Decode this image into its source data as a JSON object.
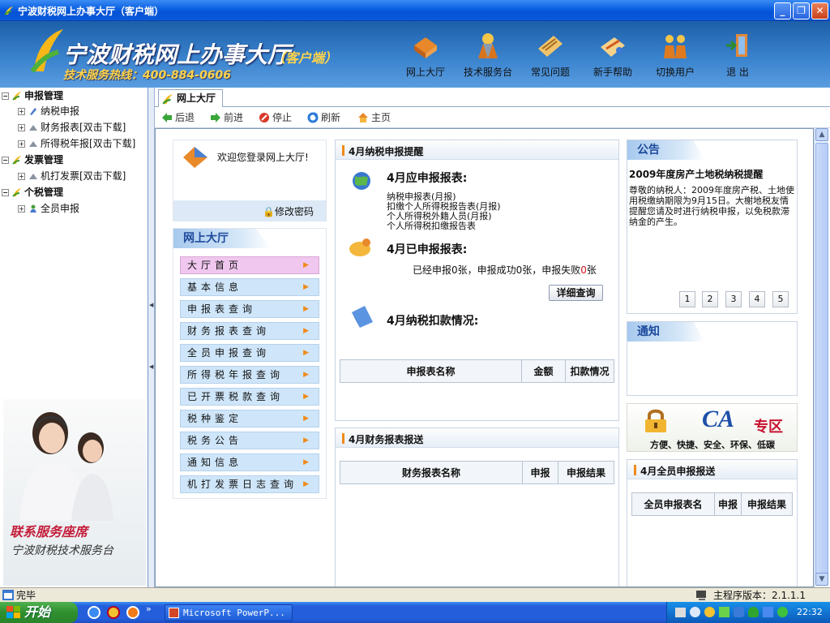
{
  "window": {
    "title": "宁波财税网上办事大厅（客户端）"
  },
  "banner": {
    "logo_text": "宁波财税网上办事大厅",
    "logo_sub": "（客户端）",
    "hotline": "技术服务热线：400-884-0606",
    "nav": [
      {
        "label": "网上大厅",
        "icon": "hall-icon"
      },
      {
        "label": "技术服务台",
        "icon": "service-desk-icon"
      },
      {
        "label": "常见问题",
        "icon": "faq-icon"
      },
      {
        "label": "新手帮助",
        "icon": "help-icon"
      },
      {
        "label": "切换用户",
        "icon": "switch-user-icon"
      },
      {
        "label": "退 出",
        "icon": "exit-icon"
      }
    ]
  },
  "tree": {
    "groups": [
      {
        "label": "申报管理",
        "children": [
          "纳税申报",
          "财务报表[双击下载]",
          "所得税年报[双击下载]"
        ]
      },
      {
        "label": "发票管理",
        "children": [
          "机打发票[双击下载]"
        ]
      },
      {
        "label": "个税管理",
        "children": [
          "全员申报"
        ]
      }
    ],
    "service": {
      "line1": "联系服务座席",
      "line2": "宁波财税技术服务台"
    }
  },
  "tabs": [
    {
      "label": "网上大厅"
    }
  ],
  "toolbar": {
    "back": "后退",
    "forward": "前进",
    "stop": "停止",
    "refresh": "刷新",
    "home": "主页"
  },
  "left_panel": {
    "welcome": "欢迎您登录网上大厅!",
    "change_password": "修改密码",
    "menu_title": "网上大厅",
    "menu": [
      "大厅首页",
      "基本信息",
      "申报表查询",
      "财务报表查询",
      "全员申报查询",
      "所得税年报查询",
      "已开票税款查询",
      "税种鉴定",
      "税务公告",
      "通知信息",
      "机打发票日志查询"
    ]
  },
  "reminder": {
    "title": "4月纳税申报提醒",
    "due_title": "4月应申报报表:",
    "due_items": [
      "纳税申报表(月报)",
      "扣缴个人所得税报告表(月报)",
      "个人所得税外籍人员(月报)",
      "个人所得税扣缴报告表"
    ],
    "done_title": "4月已申报报表:",
    "done_text": {
      "prefix": "已经申报0张，申报成功0张，申报失败",
      "fail_count": "0",
      "suffix": "张"
    },
    "detail_button": "详细查询",
    "deduct_title": "4月纳税扣款情况:",
    "deduct_columns": [
      "申报表名称",
      "金额",
      "扣款情况"
    ]
  },
  "finance": {
    "title": "4月财务报表报送",
    "columns": [
      "财务报表名称",
      "申报",
      "申报结果"
    ]
  },
  "notice": {
    "title": "公告",
    "headline": "2009年度房产土地税纳税提醒",
    "body": "尊敬的纳税人：2009年度房产税、土地使用税缴纳期限为9月15日。大榭地税友情提醒您请及时进行纳税申报，以免税款滞纳金的产生。",
    "pages": [
      "1",
      "2",
      "3",
      "4",
      "5"
    ]
  },
  "inform": {
    "title": "通知"
  },
  "ca_banner": {
    "logo": "CA",
    "zone": "专区",
    "slogan": "方便、快捷、安全、环保、低碳"
  },
  "allstaff": {
    "title": "4月全员申报报送",
    "columns": [
      "全员申报表名",
      "申报",
      "申报结果"
    ]
  },
  "status": {
    "text": "完毕",
    "version": "主程序版本：2.1.1.1"
  },
  "taskbar": {
    "start": "开始",
    "task": "Microsoft PowerP...",
    "clock": "22:32"
  },
  "colors": {
    "accent": "#f08a1a",
    "xp_blue": "#245edb",
    "menu_item": "#cfe6fa",
    "menu_active": "#f0c7ee"
  }
}
